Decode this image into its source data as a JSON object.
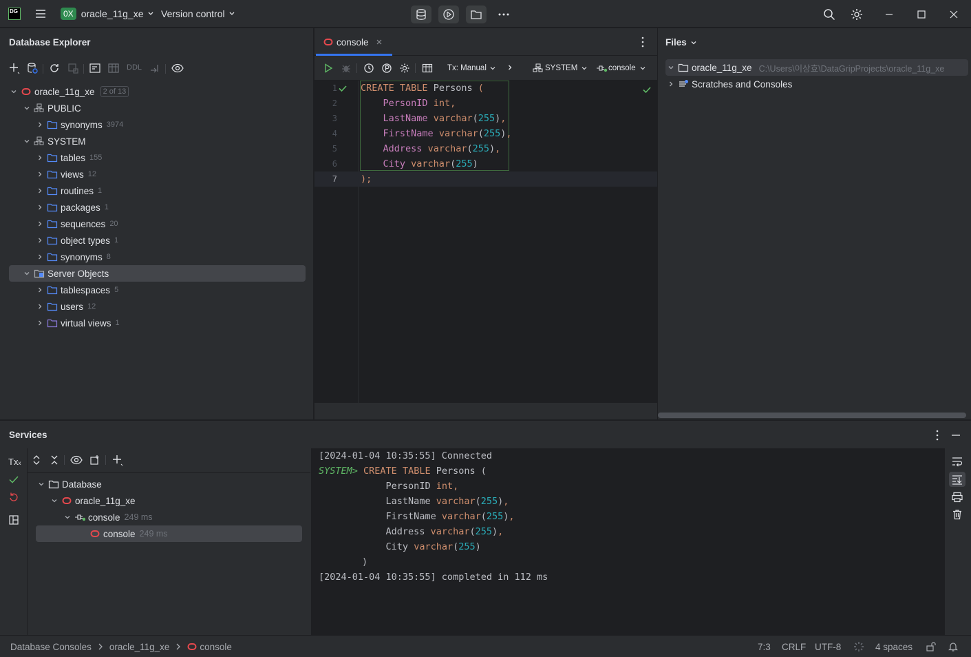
{
  "titlebar": {
    "app_logo": "DG",
    "project_badge": "0X",
    "project_name": "oracle_11g_xe",
    "vcs_label": "Version control"
  },
  "db_explorer": {
    "title": "Database Explorer",
    "toolbar_ddl": "DDL",
    "tree": [
      {
        "label": "oracle_11g_xe",
        "count": "2 of 13"
      },
      {
        "label": "PUBLIC",
        "count": ""
      },
      {
        "label": "synonyms",
        "count": "3974"
      },
      {
        "label": "SYSTEM",
        "count": ""
      },
      {
        "label": "tables",
        "count": "155"
      },
      {
        "label": "views",
        "count": "12"
      },
      {
        "label": "routines",
        "count": "1"
      },
      {
        "label": "packages",
        "count": "1"
      },
      {
        "label": "sequences",
        "count": "20"
      },
      {
        "label": "object types",
        "count": "1"
      },
      {
        "label": "synonyms",
        "count": "8"
      },
      {
        "label": "Server Objects",
        "count": ""
      },
      {
        "label": "tablespaces",
        "count": "5"
      },
      {
        "label": "users",
        "count": "12"
      },
      {
        "label": "virtual views",
        "count": "1"
      }
    ]
  },
  "editor": {
    "tab_label": "console",
    "tx_mode": "Tx: Manual",
    "schema": "SYSTEM",
    "session": "console",
    "line_numbers": [
      "1",
      "2",
      "3",
      "4",
      "5",
      "6",
      "7"
    ],
    "code": {
      "l1_kw": "CREATE TABLE",
      "l1_name": "Persons",
      "l1_paren": "(",
      "l2_col": "PersonID",
      "l2_type": "int",
      "l3_col": "LastName",
      "l3_type": "varchar",
      "l3_num": "255",
      "l4_col": "FirstName",
      "l4_type": "varchar",
      "l4_num": "255",
      "l5_col": "Address",
      "l5_type": "varchar",
      "l5_num": "255",
      "l6_col": "City",
      "l6_type": "varchar",
      "l6_num": "255",
      "l7": ");"
    }
  },
  "files": {
    "title": "Files",
    "root_label": "oracle_11g_xe",
    "root_path": "C:\\Users\\이상효\\DataGripProjects\\oracle_11g_xe",
    "scratches_label": "Scratches and Consoles"
  },
  "services": {
    "title": "Services",
    "tx_label": "Tx",
    "tree": [
      {
        "label": "Database",
        "time": ""
      },
      {
        "label": "oracle_11g_xe",
        "time": ""
      },
      {
        "label": "console",
        "time": "249 ms"
      },
      {
        "label": "console",
        "time": "249 ms"
      }
    ],
    "output": {
      "l1": "[2024-01-04 10:35:55] Connected",
      "prompt": "SYSTEM>",
      "l2_kw": "CREATE TABLE",
      "l2_name": "Persons (",
      "l3_col": "PersonID",
      "l3_type": "int",
      "l4_col": "LastName",
      "l4_type": "varchar",
      "l4_num": "255",
      "l5_col": "FirstName",
      "l5_type": "varchar",
      "l5_num": "255",
      "l6_col": "Address",
      "l6_type": "varchar",
      "l6_num": "255",
      "l7_col": "City",
      "l7_type": "varchar",
      "l7_num": "255",
      "l8": ")",
      "l9": "[2024-01-04 10:35:55] completed in 112 ms"
    }
  },
  "statusbar": {
    "breadcrumb": [
      "Database Consoles",
      "oracle_11g_xe",
      "console"
    ],
    "position": "7:3",
    "line_ending": "CRLF",
    "encoding": "UTF-8",
    "indent": "4 spaces"
  },
  "colors": {
    "accent": "#3574f0",
    "oracle_red": "#e5484d",
    "success_green": "#5fb865",
    "keyword": "#cf8e6d",
    "identifier": "#c77dbb",
    "number": "#2aacb8"
  }
}
